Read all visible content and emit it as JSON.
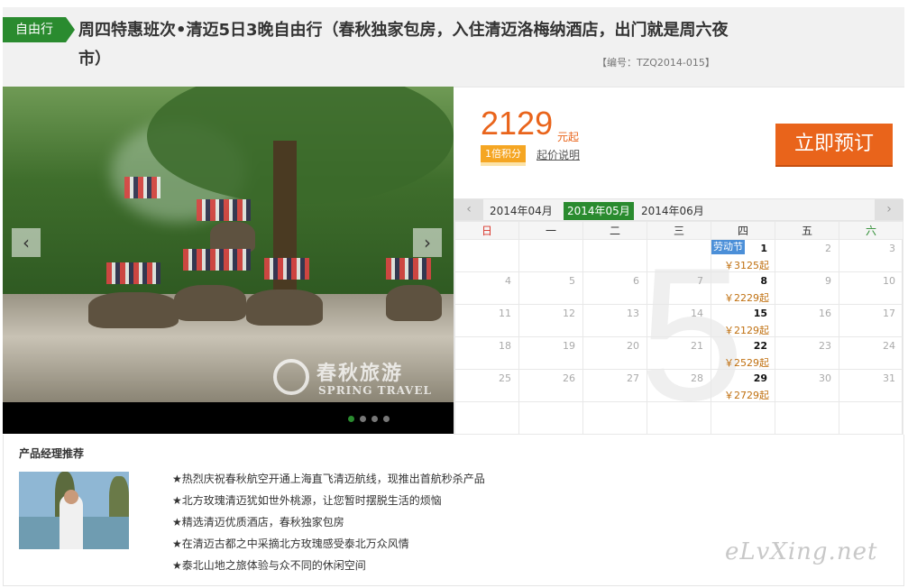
{
  "header": {
    "tag": "自由行",
    "title": "周四特惠班次•清迈5日3晚自由行（春秋独家包房，入住清迈洛梅纳酒店，出门就是周六夜市）",
    "code": "【编号：TZQ2014-015】"
  },
  "gallery": {
    "watermark_cn": "春秋旅游",
    "watermark_en": "SPRING TRAVEL",
    "prev_icon": "‹",
    "next_icon": "›",
    "dot_count": 4,
    "active_dot": 0
  },
  "price_panel": {
    "price": "2129",
    "unit": "元起",
    "points": "1倍积分",
    "explain": "起价说明",
    "book": "立即预订"
  },
  "calendar": {
    "prev_icon": "‹",
    "next_icon": "›",
    "months": [
      "2014年04月",
      "2014年05月",
      "2014年06月"
    ],
    "active_month": 1,
    "big_digit": "5",
    "weekdays": [
      "日",
      "一",
      "二",
      "三",
      "四",
      "五",
      "六"
    ],
    "weeks": [
      [
        {
          "day": ""
        },
        {
          "day": ""
        },
        {
          "day": ""
        },
        {
          "day": ""
        },
        {
          "day": "1",
          "price": "￥3125起",
          "holiday": "劳动节"
        },
        {
          "day": "2"
        },
        {
          "day": "3"
        }
      ],
      [
        {
          "day": "4"
        },
        {
          "day": "5"
        },
        {
          "day": "6"
        },
        {
          "day": "7"
        },
        {
          "day": "8",
          "price": "￥2229起"
        },
        {
          "day": "9"
        },
        {
          "day": "10"
        }
      ],
      [
        {
          "day": "11"
        },
        {
          "day": "12"
        },
        {
          "day": "13"
        },
        {
          "day": "14"
        },
        {
          "day": "15",
          "price": "￥2129起"
        },
        {
          "day": "16"
        },
        {
          "day": "17"
        }
      ],
      [
        {
          "day": "18"
        },
        {
          "day": "19"
        },
        {
          "day": "20"
        },
        {
          "day": "21"
        },
        {
          "day": "22",
          "price": "￥2529起"
        },
        {
          "day": "23"
        },
        {
          "day": "24"
        }
      ],
      [
        {
          "day": "25"
        },
        {
          "day": "26"
        },
        {
          "day": "27"
        },
        {
          "day": "28"
        },
        {
          "day": "29",
          "price": "￥2729起"
        },
        {
          "day": "30"
        },
        {
          "day": "31"
        }
      ],
      [
        {
          "day": ""
        },
        {
          "day": ""
        },
        {
          "day": ""
        },
        {
          "day": ""
        },
        {
          "day": ""
        },
        {
          "day": ""
        },
        {
          "day": ""
        }
      ]
    ]
  },
  "recommend": {
    "title": "产品经理推荐",
    "items": [
      "★热烈庆祝春秋航空开通上海直飞清迈航线，现推出首航秒杀产品",
      "★北方玫瑰清迈犹如世外桃源，让您暂时摆脱生活的烦恼",
      "★精选清迈优质酒店，春秋独家包房",
      "★在清迈古都之中采摘北方玫瑰感受泰北万众风情",
      "★泰北山地之旅体验与众不同的休闲空间"
    ],
    "brand": "eLvXing.net"
  }
}
